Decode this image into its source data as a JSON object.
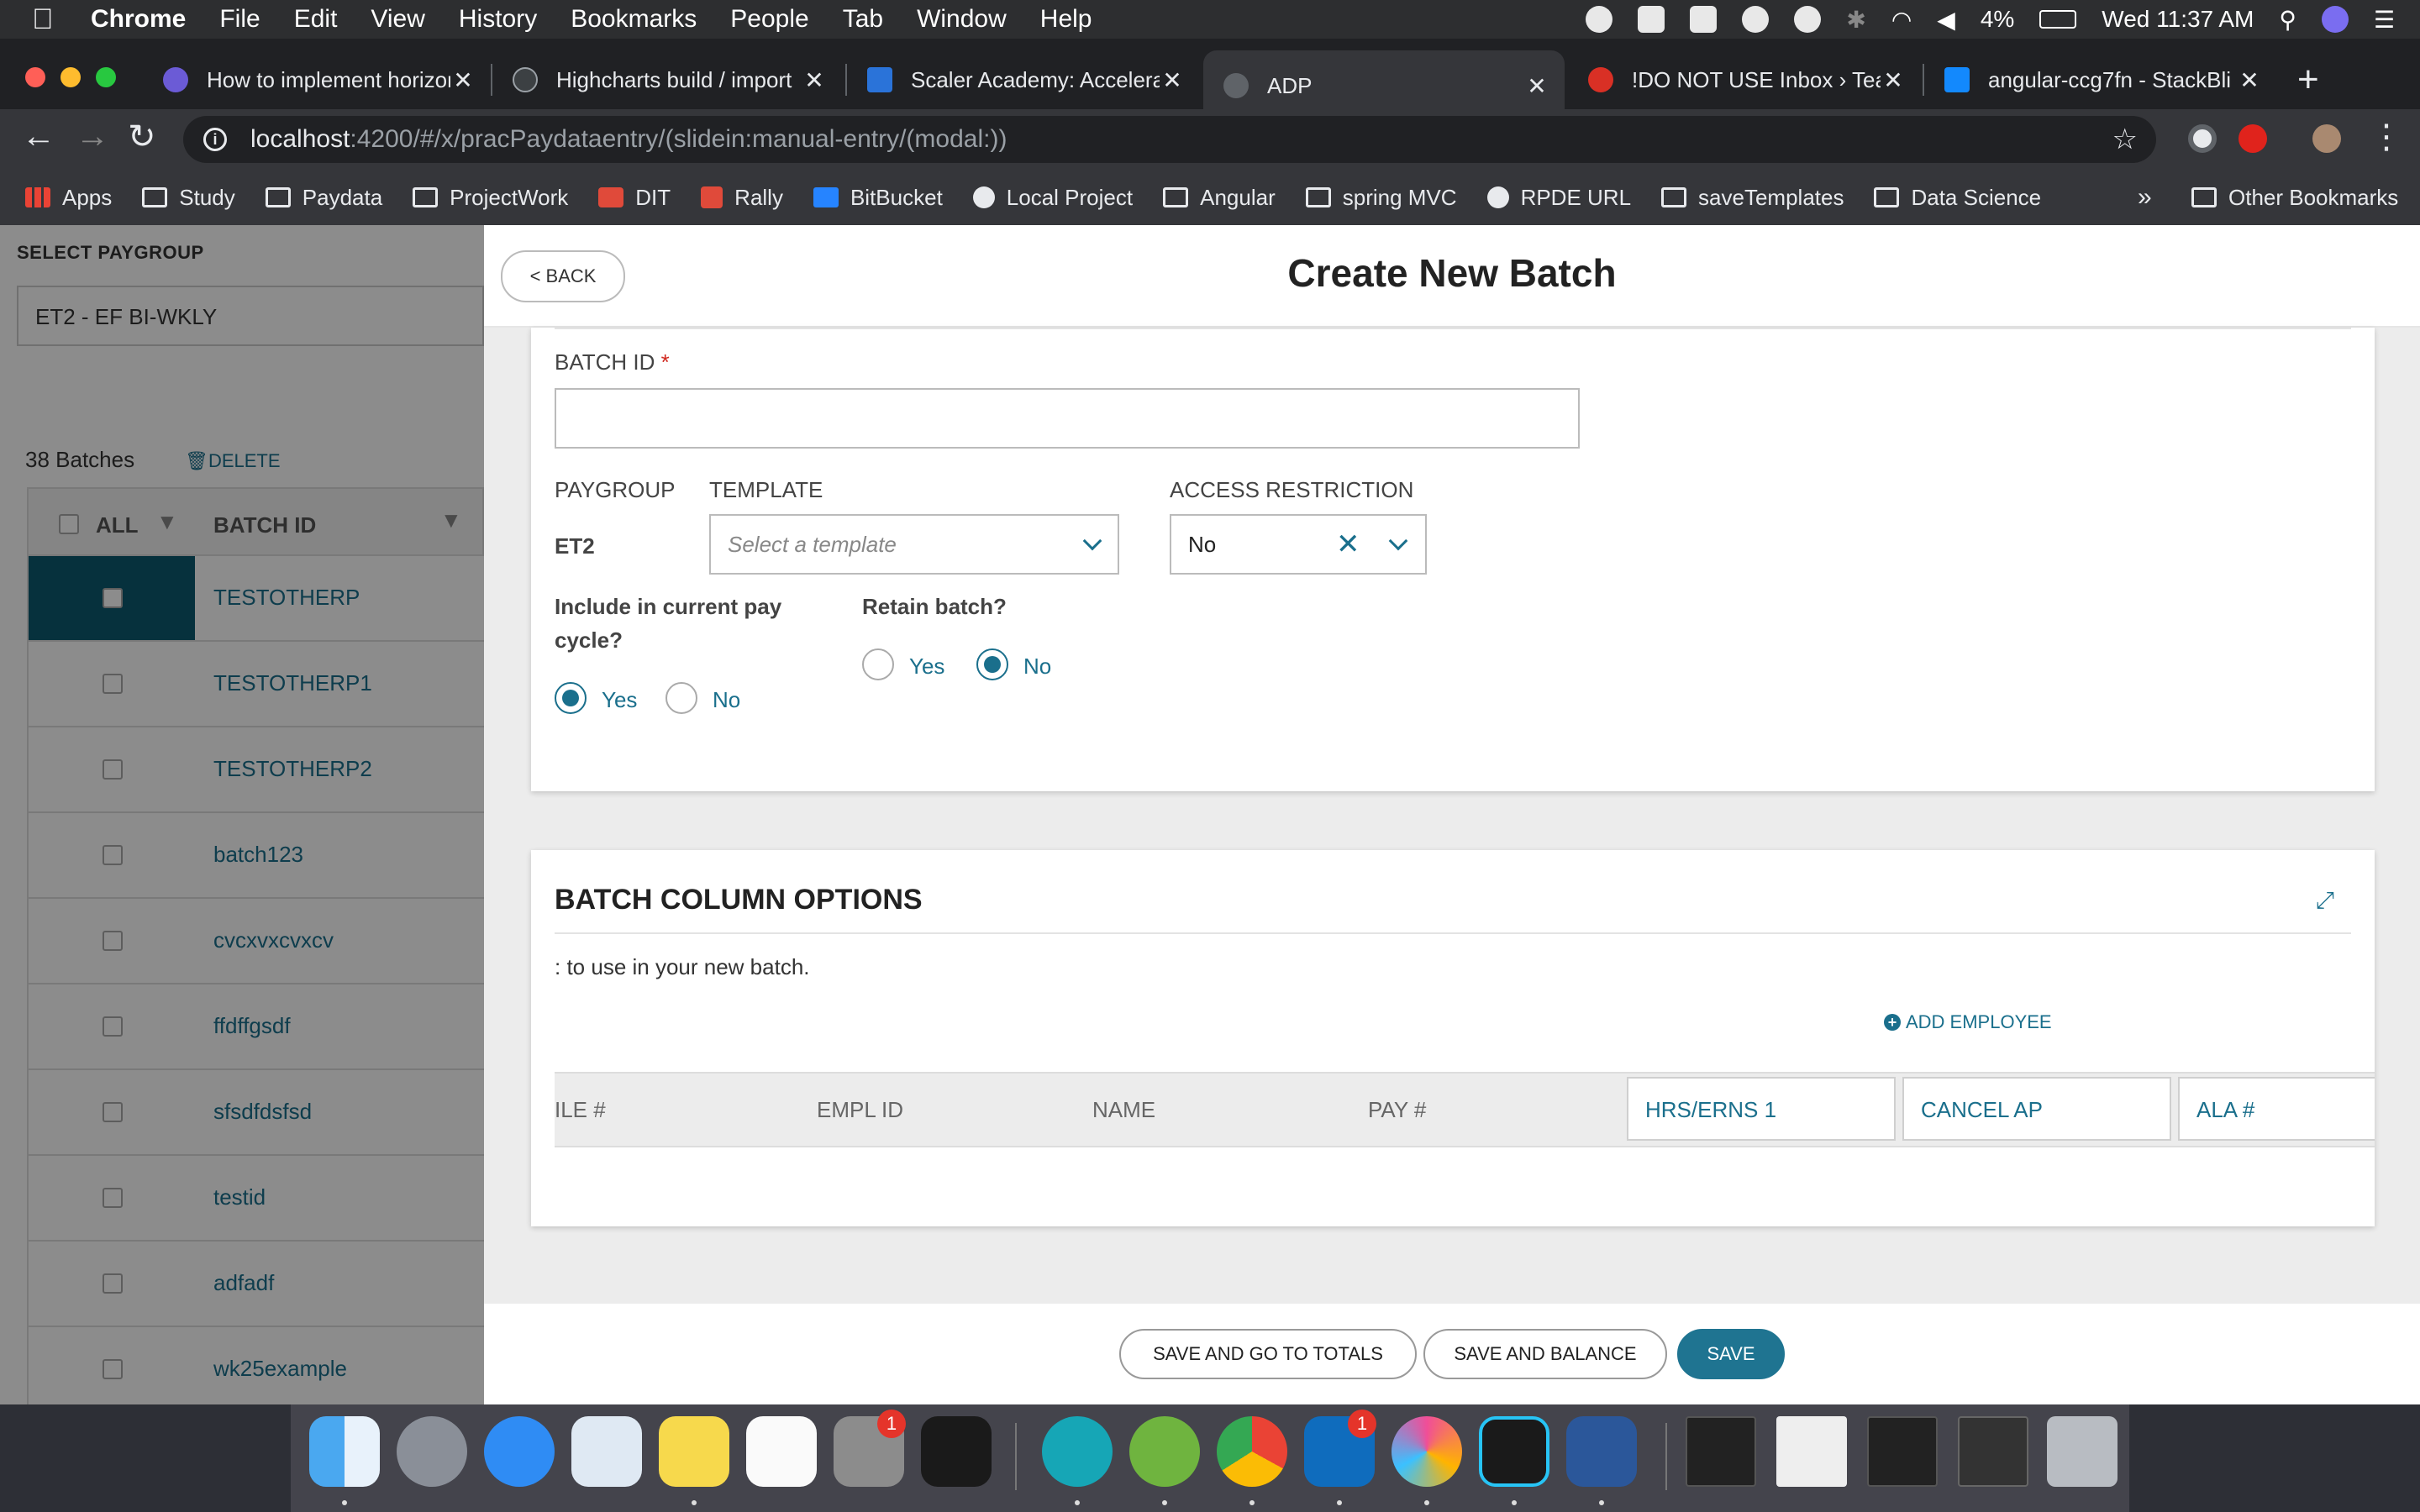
{
  "menubar": {
    "app": "Chrome",
    "items": [
      "File",
      "Edit",
      "View",
      "History",
      "Bookmarks",
      "People",
      "Tab",
      "Window",
      "Help"
    ],
    "battery": "4%",
    "clock": "Wed 11:37 AM"
  },
  "tabs": [
    {
      "label": "How to implement horizon",
      "active": false
    },
    {
      "label": "Highcharts build / import",
      "active": false
    },
    {
      "label": "Scaler Academy: Accelera",
      "active": false
    },
    {
      "label": "ADP",
      "active": true
    },
    {
      "label": "!DO NOT USE Inbox › Tear",
      "active": false
    },
    {
      "label": "angular-ccg7fn - StackBli",
      "active": false
    }
  ],
  "address": {
    "host": "localhost",
    "path": ":4200/#/x/pracPaydataentry/(slidein:manual-entry/(modal:))"
  },
  "bookmarks": [
    "Apps",
    "Study",
    "Paydata",
    "ProjectWork",
    "DIT",
    "Rally",
    "BitBucket",
    "Local Project",
    "Angular",
    "spring MVC",
    "RPDE URL",
    "saveTemplates",
    "Data Science"
  ],
  "bookmarks_more": "»",
  "bookmarks_other": "Other Bookmarks",
  "left_panel": {
    "paygroup_label": "SELECT PAYGROUP",
    "paygroup_value": "ET2 - EF BI-WKLY",
    "batch_count": "38 Batches",
    "delete_label": "DELETE",
    "col_all": "ALL",
    "col_batch_id": "BATCH ID",
    "rows": [
      "TESTOTHERP",
      "TESTOTHERP1",
      "TESTOTHERP2",
      "batch123",
      "cvcxvxcvxcv",
      "ffdffgsdf",
      "sfsdfdsfsd",
      "testid",
      "adfadf",
      "wk25example"
    ]
  },
  "slidein": {
    "back_label": "< BACK",
    "title": "Create New Batch",
    "batch_id_label": "BATCH ID",
    "batch_id_required": "*",
    "batch_id_value": "",
    "paygroup_label": "PAYGROUP",
    "paygroup_value": "ET2",
    "template_label": "TEMPLATE",
    "template_placeholder": "Select a template",
    "access_label": "ACCESS RESTRICTION",
    "access_value": "No",
    "include_label": "Include in current pay cycle?",
    "include_yes": "Yes",
    "include_no": "No",
    "include_selected": "Yes",
    "retain_label": "Retain batch?",
    "retain_yes": "Yes",
    "retain_no": "No",
    "retain_selected": "No",
    "columns_title": "BATCH COLUMN OPTIONS",
    "columns_instructions": ": to use in your new batch.",
    "add_employee": "ADD EMPLOYEE",
    "column_headers": [
      "ILE #",
      "EMPL ID",
      "NAME",
      "PAY #"
    ],
    "column_options": [
      "HRS/ERNS 1",
      "CANCEL AP",
      "ALA #"
    ],
    "footer_buttons": {
      "totals": "SAVE AND GO TO TOTALS",
      "balance": "SAVE AND BALANCE",
      "save": "SAVE"
    }
  },
  "dock": {
    "apps": [
      "Finder",
      "Launchpad",
      "Safari",
      "Mail",
      "Notes",
      "Reminders",
      "System Preferences",
      "Activity Monitor",
      "Webex",
      "Cisco AnyConnect",
      "Chrome",
      "Outlook",
      "Sketchbook",
      "WebStorm",
      "Word"
    ],
    "badges": {
      "System Preferences": "1",
      "Outlook": "1"
    }
  }
}
